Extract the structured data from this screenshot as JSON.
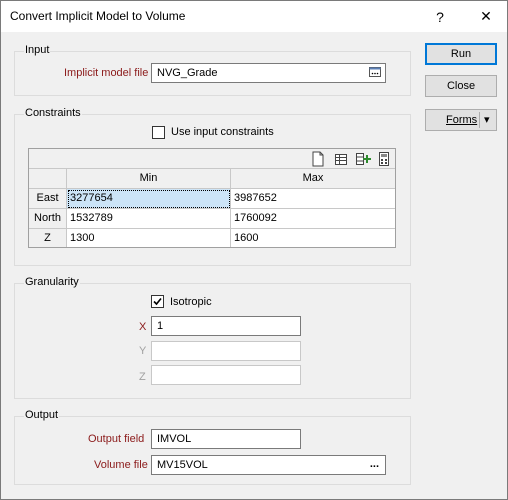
{
  "window": {
    "title": "Convert Implicit Model to Volume",
    "help_label": "?",
    "close_label": "✕"
  },
  "buttons": {
    "run": "Run",
    "close": "Close",
    "forms": "Forms",
    "forms_arrow": "▾"
  },
  "input": {
    "group_title": "Input",
    "implicit_model_label": "Implicit model file",
    "implicit_model_value": "NVG_Grade"
  },
  "constraints": {
    "group_title": "Constraints",
    "use_input_label": "Use input constraints",
    "use_input_checked": false,
    "columns": [
      "Min",
      "Max"
    ],
    "rows": [
      {
        "label": "East",
        "min": "3277654",
        "max": "3987652"
      },
      {
        "label": "North",
        "min": "1532789",
        "max": "1760092"
      },
      {
        "label": "Z",
        "min": "1300",
        "max": "1600"
      }
    ]
  },
  "granularity": {
    "group_title": "Granularity",
    "isotropic_label": "Isotropic",
    "isotropic_checked": true,
    "x_label": "X",
    "x_value": "1",
    "y_label": "Y",
    "y_value": "",
    "z_label": "Z",
    "z_value": ""
  },
  "output": {
    "group_title": "Output",
    "output_field_label": "Output field",
    "output_field_value": "IMVOL",
    "volume_file_label": "Volume file",
    "volume_file_value": "MV15VOL",
    "browse_label": "..."
  }
}
